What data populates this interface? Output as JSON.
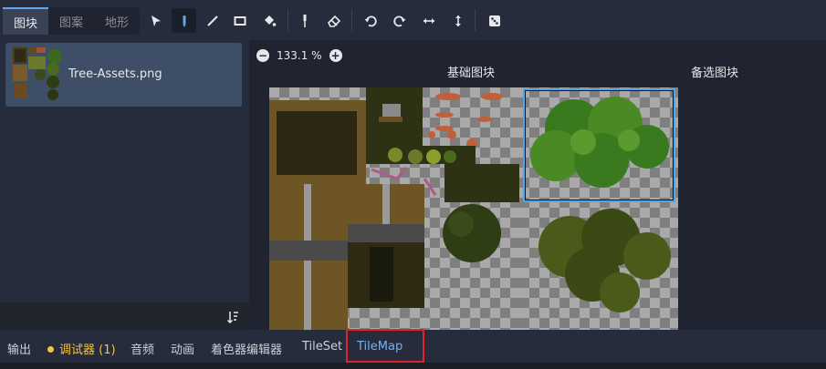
{
  "tabs": [
    {
      "label": "图块",
      "active": true
    },
    {
      "label": "图案",
      "active": false
    },
    {
      "label": "地形",
      "active": false
    }
  ],
  "tools": [
    {
      "icon": "select-arrow-icon"
    },
    {
      "icon": "paint-pencil-icon",
      "active": true
    },
    {
      "icon": "line-icon"
    },
    {
      "icon": "rect-icon"
    },
    {
      "icon": "bucket-fill-icon"
    },
    {
      "icon": "picker-icon"
    },
    {
      "icon": "eraser-icon"
    },
    {
      "icon": "rotate-left-icon"
    },
    {
      "icon": "rotate-right-icon"
    },
    {
      "icon": "flip-h-icon"
    },
    {
      "icon": "flip-v-icon"
    },
    {
      "icon": "random-dice-icon"
    }
  ],
  "atlas": {
    "file_name": "Tree-Assets.png"
  },
  "viewer": {
    "zoom_minus": "−",
    "zoom_plus": "+",
    "zoom_value": "133.1 %",
    "base_tiles_title": "基础图块",
    "alt_tiles_title": "备选图块"
  },
  "bottom": {
    "output": "输出",
    "debugger": "调试器 (1)",
    "audio": "音频",
    "animation": "动画",
    "shader_editor": "着色器编辑器",
    "tileset": "TileSet",
    "tilemap": "TileMap"
  },
  "colors": {
    "accent": "#5fa8ef",
    "highlight_box": "#e0222a",
    "debug": "#f0c44a"
  }
}
